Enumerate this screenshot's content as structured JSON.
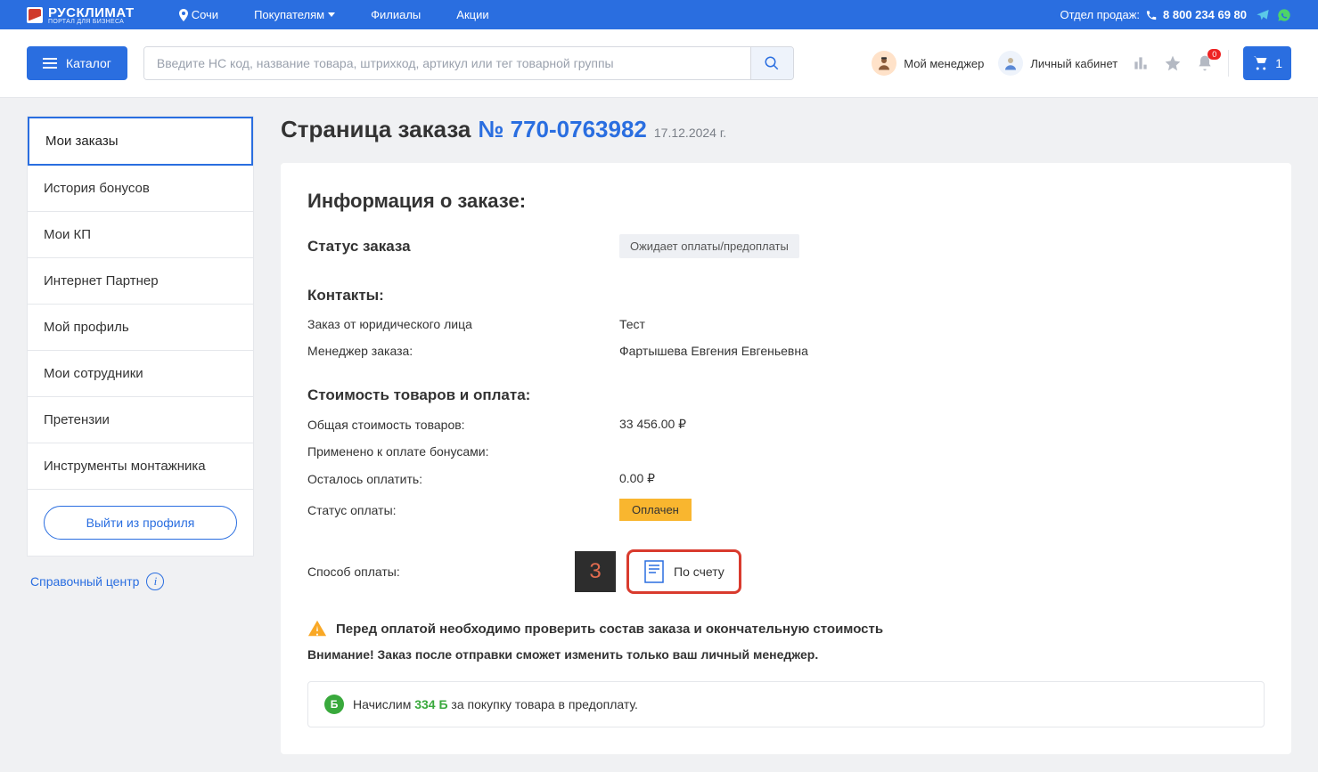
{
  "topbar": {
    "logo": "РУСКЛИМАТ",
    "logo_sub": "ПОРТАЛ ДЛЯ БИЗНЕСА",
    "city": "Сочи",
    "nav": [
      "Покупателям",
      "Филиалы",
      "Акции"
    ],
    "sales_label": "Отдел продаж:",
    "phone": "8 800 234 69 80"
  },
  "toolbar": {
    "catalog": "Каталог",
    "search_placeholder": "Введите НС код, название товара, штрихкод, артикул или тег товарной группы",
    "manager": "Мой менеджер",
    "cabinet": "Личный кабинет",
    "notif_badge": "0",
    "cart_count": "1"
  },
  "sidebar": {
    "items": [
      "Мои заказы",
      "История бонусов",
      "Мои КП",
      "Интернет Партнер",
      "Мой профиль",
      "Мои сотрудники",
      "Претензии",
      "Инструменты монтажника"
    ],
    "logout": "Выйти из профиля",
    "help": "Справочный центр"
  },
  "order": {
    "page_title": "Страница заказа",
    "number_prefix": "№ ",
    "number": "770-0763982",
    "date": "17.12.2024 г.",
    "info_header": "Информация о заказе:",
    "status_label": "Статус заказа",
    "status_value": "Ожидает оплаты/предоплаты",
    "contacts_header": "Контакты:",
    "legal_label": "Заказ от юридического лица",
    "legal_value": "Тест",
    "manager_label": "Менеджер заказа:",
    "manager_value": "Фартышева Евгения Евгеньевна",
    "cost_header": "Стоимость товаров и оплата:",
    "total_label": "Общая стоимость товаров:",
    "total_value": "33 456.00 ₽",
    "bonus_applied_label": "Применено к оплате бонусами:",
    "remain_label": "Осталось оплатить:",
    "remain_value": "0.00 ₽",
    "pay_status_label": "Статус оплаты:",
    "pay_status_value": "Оплачен",
    "pay_method_label": "Способ оплаты:",
    "pay_method_value": "По счету",
    "step_num": "3",
    "warning": "Перед оплатой необходимо проверить состав заказа и окончательную стоимость",
    "attention": "Внимание! Заказ после отправки сможет изменить только ваш личный менеджер.",
    "bonus_pre": "Начислим ",
    "bonus_val": "334 Б",
    "bonus_post": " за покупку товара в предоплату."
  }
}
